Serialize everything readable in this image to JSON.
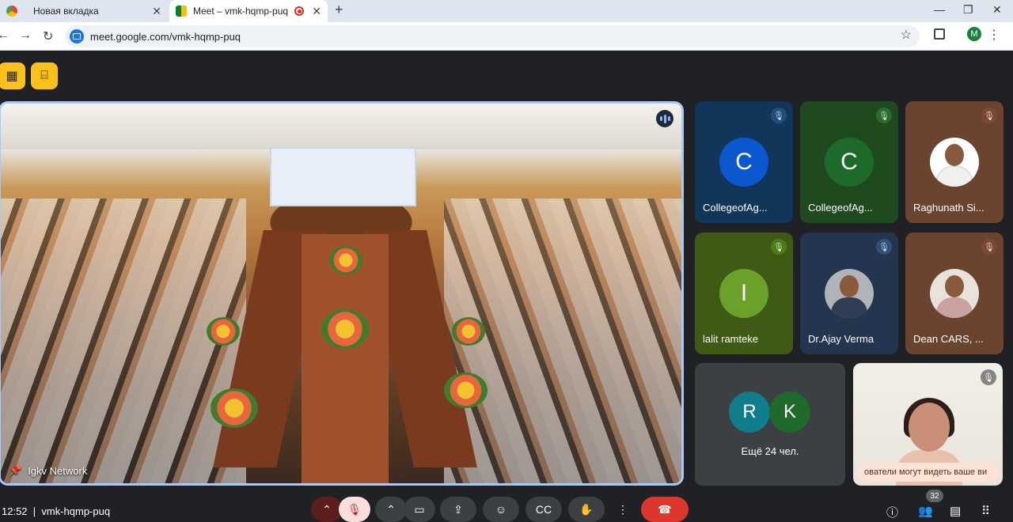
{
  "browser": {
    "tabs": [
      {
        "title": "Новая вкладка",
        "icon": "chrome-icon",
        "active": false
      },
      {
        "title": "Meet – vmk-hqmp-puq",
        "icon": "meet-icon",
        "active": true,
        "recording": true
      }
    ],
    "url": "meet.google.com/vmk-hqmp-puq",
    "profile_initial": "M"
  },
  "meet": {
    "top_icons": [
      "presentation-off-icon",
      "building-icon"
    ],
    "stage": {
      "name": "Igkv Network",
      "speaking": true
    },
    "tiles": [
      {
        "name": "CollegeofAg...",
        "initial": "C",
        "bg": "#12365a",
        "avatar_color": "#0b57d0",
        "mute_bg": "#1f4f7a"
      },
      {
        "name": "CollegeofAg...",
        "initial": "C",
        "bg": "#1f4a1f",
        "avatar_color": "#1e6a2a",
        "mute_bg": "#2d6a2d"
      },
      {
        "name": "Raghunath Si...",
        "photo": true,
        "bg": "#6b4430",
        "mute_bg": "#7a4a34",
        "shirt": "#f0f0f0"
      },
      {
        "name": "lalit ramteke",
        "initial": "I",
        "bg": "#3e5a14",
        "avatar_color": "#6aa12a",
        "mute_bg": "#4f7a1a"
      },
      {
        "name": "Dr.Ajay Verma",
        "photo": true,
        "bg": "#24354f",
        "mute_bg": "#34507a",
        "shirt": "#2f3e54"
      },
      {
        "name": "Dean CARS, ...",
        "photo": true,
        "bg": "#6b4430",
        "mute_bg": "#7a4a34",
        "shirt": "#c9a3a0"
      }
    ],
    "more": {
      "initials": [
        "R",
        "K"
      ],
      "colors": [
        "#0f7d8c",
        "#1e6a2a"
      ],
      "label": "Ещё 24 чел."
    },
    "self_notice": "ователи могут видеть ваше ви",
    "clock": "12:52",
    "meeting_code": "vmk-hqmp-puq",
    "participants_count": "32"
  }
}
